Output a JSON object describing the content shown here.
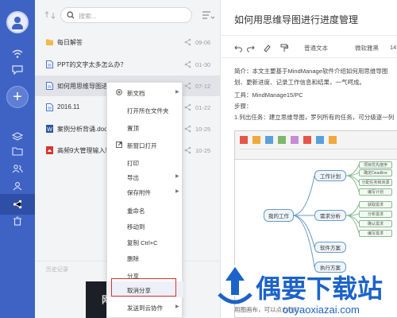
{
  "sidebar": {
    "icons": [
      "user-avatar-icon",
      "wifi-icon",
      "chat-icon",
      "add-icon",
      "layers-icon",
      "folder-icon",
      "people-icon",
      "group-icon",
      "share-icon",
      "trash-icon"
    ]
  },
  "search": {
    "placeholder": "搜索..."
  },
  "files": [
    {
      "name": "每日解答",
      "date": "09-06",
      "type": "folder"
    },
    {
      "name": "PPT的文字太多怎么办？",
      "date": "01-30",
      "type": "doc"
    },
    {
      "name": "如何用思维导图进行进度管理",
      "date": "07-12",
      "type": "doc"
    },
    {
      "name": "2016.11",
      "date": "01-22",
      "type": "doc"
    },
    {
      "name": "案例分析背诵.docx",
      "date": "10-25",
      "type": "word"
    },
    {
      "name": "高频9大管理输入输出",
      "date": "10-25",
      "type": "pdf"
    }
  ],
  "history_label": "历史记录",
  "context_menu": {
    "items": [
      {
        "label": "新文档",
        "submenu": true
      },
      {
        "label": "打开所在文件夹",
        "submenu": false
      },
      {
        "label": "置顶",
        "submenu": false
      },
      {
        "label": "新窗口打开",
        "submenu": false
      },
      {
        "label": "打印",
        "submenu": false
      },
      {
        "label": "导出",
        "submenu": true
      },
      {
        "label": "保存附件",
        "submenu": true
      },
      {
        "label": "重命名",
        "submenu": false
      },
      {
        "label": "移动到",
        "submenu": false
      },
      {
        "label": "复制 Ctrl+C",
        "submenu": false
      },
      {
        "label": "删除",
        "submenu": false
      },
      {
        "label": "分享",
        "submenu": false
      },
      {
        "label": "取消分享",
        "submenu": false
      },
      {
        "label": "发送到云协作",
        "submenu": true
      }
    ],
    "highlighted": "取消分享"
  },
  "document": {
    "title": "如何用思维导图进行进度管理",
    "toolbar": {
      "style": "普通文本",
      "font": "微软雅黑",
      "size": "14"
    },
    "paragraphs": [
      "简介：本文主要基于MindManage软件介绍如何用思维导图",
      "划、更新进度、记录工作信息和结果，一气呵成。",
      "工具：MindManage15/PC",
      "步骤：",
      "1.列出任务：建立思维导图，罗列所有的任务，可分级逐一列"
    ],
    "footer_fragment": "用图画布，可以点击数标…"
  },
  "mindmap": {
    "center": "我的工作",
    "branches": [
      "工作计划",
      "需求分析",
      "软件方案",
      "执行方案"
    ],
    "leaves": [
      "项目优先度序",
      "确定Deadline",
      "分配任务和资源",
      "编写计划",
      "获取需求",
      "分析需求",
      "确认需求",
      "编写需求"
    ]
  },
  "watermark": {
    "text": "偶要下载站",
    "url": "ouyaoxiazai.com"
  },
  "colors": {
    "rail": "#3f63c4",
    "accent": "#1c63c9",
    "highlight_border": "#e03131"
  }
}
